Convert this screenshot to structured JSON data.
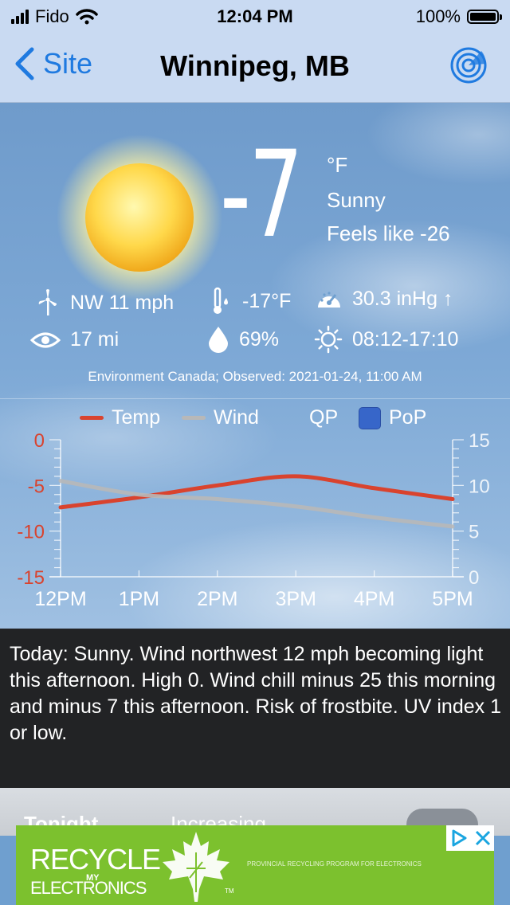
{
  "status_bar": {
    "carrier": "Fido",
    "time": "12:04 PM",
    "battery": "100%"
  },
  "nav": {
    "back_label": "Site",
    "title": "Winnipeg, MB"
  },
  "current": {
    "temperature": "-7",
    "unit": "°F",
    "condition": "Sunny",
    "feels_like": "Feels like -26",
    "wind": "NW 11 mph",
    "dew_point": "-17°F",
    "pressure": "30.3 inHg ↑",
    "visibility": "17 mi",
    "humidity": "69%",
    "sun_times": "08:12-17:10",
    "observed": "Environment Canada; Observed: 2021-01-24, 11:00 AM"
  },
  "legend": {
    "temp": "Temp",
    "wind": "Wind",
    "qp": "QP",
    "pop": "PoP"
  },
  "colors": {
    "temp_line": "#d9432e",
    "wind_line": "#b8b8b8",
    "pop_box": "#3766c9",
    "ad_green": "#7cc12e"
  },
  "chart_data": {
    "type": "line",
    "x": [
      "12PM",
      "1PM",
      "2PM",
      "3PM",
      "4PM",
      "5PM"
    ],
    "series": [
      {
        "name": "Temp",
        "axis": "left",
        "values": [
          -7.4,
          -6.3,
          -5.0,
          -4.0,
          -5.3,
          -6.5
        ]
      },
      {
        "name": "Wind",
        "axis": "right",
        "values": [
          10.5,
          9.0,
          8.5,
          7.7,
          6.5,
          5.5
        ]
      }
    ],
    "y_left": {
      "ticks": [
        "0",
        "-5",
        "-10",
        "-15"
      ],
      "ylim": [
        -15,
        0
      ]
    },
    "y_right": {
      "ticks": [
        "15",
        "10",
        "5",
        "0"
      ],
      "ylim": [
        0,
        15
      ]
    }
  },
  "forecast_text": "Today:  Sunny. Wind northwest 12 mph becoming light this afternoon. High 0. Wind chill minus 25 this morning and minus 7 this afternoon. Risk of frostbite. UV index 1 or low.",
  "tonight": {
    "label": "Tonight",
    "text": "Increasing"
  },
  "ad": {
    "line1": "RECYCLE",
    "line2": "MY",
    "line3": "ELECTRONICS",
    "tm": "TM",
    "tagline": "PROVINCIAL RECYCLING PROGRAM FOR ELECTRONICS"
  }
}
